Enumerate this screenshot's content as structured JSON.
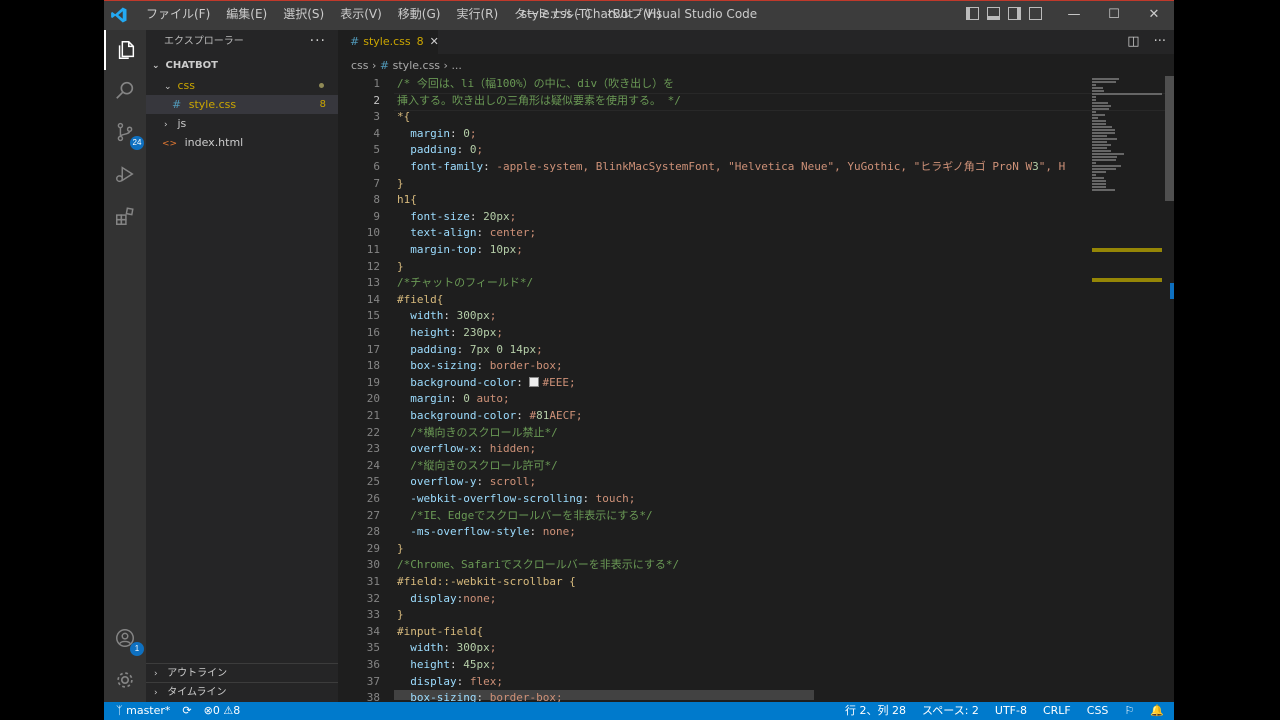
{
  "window": {
    "title": "style.css - ChatBot - Visual Studio Code",
    "menu": [
      "ファイル(F)",
      "編集(E)",
      "選択(S)",
      "表示(V)",
      "移動(G)",
      "実行(R)",
      "ターミナル(T)",
      "ヘルプ(H)"
    ]
  },
  "activity": {
    "scm_badge": "24",
    "accounts_badge": "1"
  },
  "sidebar": {
    "title": "エクスプローラー",
    "project": "CHATBOT",
    "tree": [
      {
        "label": "css",
        "type": "folder-open"
      },
      {
        "label": "style.css",
        "type": "file-css",
        "count": "8"
      },
      {
        "label": "js",
        "type": "folder"
      },
      {
        "label": "index.html",
        "type": "file-html"
      }
    ],
    "outline": "アウトライン",
    "timeline": "タイムライン"
  },
  "tab": {
    "name": "style.css",
    "problems": "8"
  },
  "breadcrumb": {
    "folder": "css",
    "file": "style.css",
    "more": "..."
  },
  "code_lines": [
    "/* 今回は、li（幅100%）の中に、div（吹き出し）を",
    "挿入する。吹き出しの三角形は疑似要素を使用する。 */",
    "*{",
    "  margin: 0;",
    "  padding: 0;",
    "  font-family: -apple-system, BlinkMacSystemFont, \"Helvetica Neue\", YuGothic, \"ヒラギノ角ゴ ProN W3\", H",
    "}",
    "h1{",
    "  font-size: 20px;",
    "  text-align: center;",
    "  margin-top: 10px;",
    "}",
    "/*チャットのフィールド*/",
    "#field{",
    "  width: 300px;",
    "  height: 230px;",
    "  padding: 7px 0 14px;",
    "  box-sizing: border-box;",
    "  background-color: #EEE;",
    "  margin: 0 auto;",
    "  background-color: #81AECF;",
    "  /*横向きのスクロール禁止*/",
    "  overflow-x: hidden;",
    "  /*縦向きのスクロール許可*/",
    "  overflow-y: scroll;",
    "  -webkit-overflow-scrolling: touch;",
    "  /*IE、Edgeでスクロールバーを非表示にする*/",
    "  -ms-overflow-style: none;",
    "}",
    "/*Chrome、Safariでスクロールバーを非表示にする*/",
    "#field::-webkit-scrollbar {",
    "  display:none;",
    "}",
    "#input-field{",
    "  width: 300px;",
    "  height: 45px;",
    "  display: flex;",
    "  box-sizing: border-box;"
  ],
  "colors": {
    "swatch_eee": "#EEEEEE",
    "swatch_81aecf": "#81AECF",
    "accent": "#007acc"
  },
  "status": {
    "branch": "master*",
    "errors": "0",
    "warnings": "8",
    "position": "行 2、列 28",
    "spaces": "スペース: 2",
    "encoding": "UTF-8",
    "eol": "CRLF",
    "language": "CSS"
  }
}
